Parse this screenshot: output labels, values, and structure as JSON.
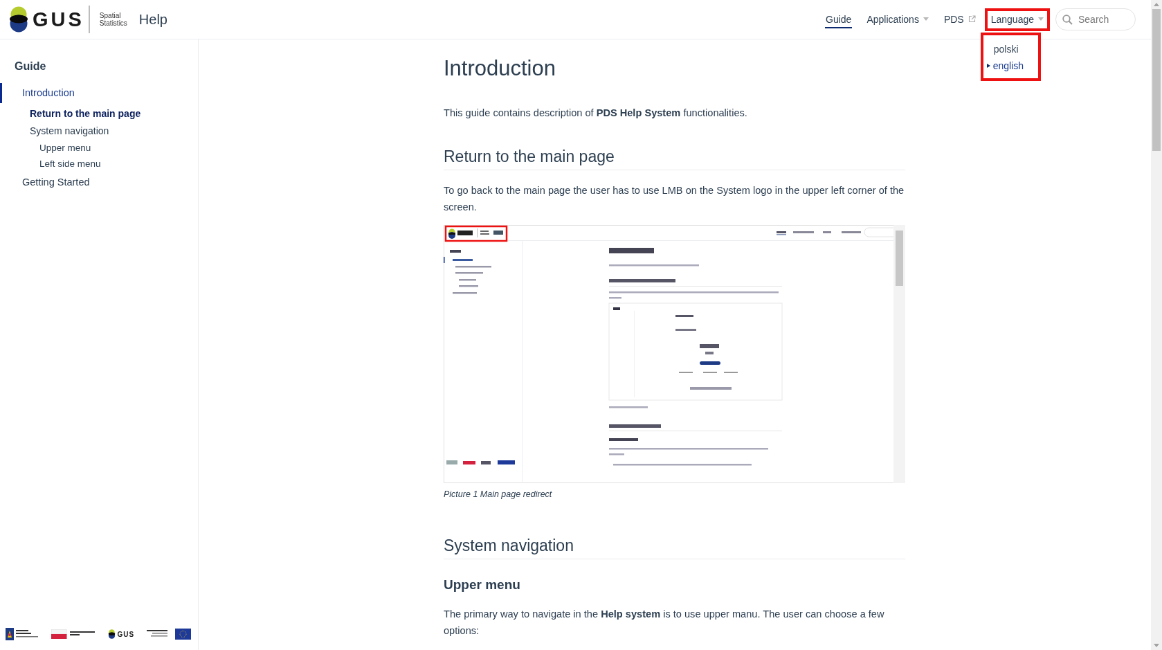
{
  "header": {
    "logo": {
      "wordmark": "GUS",
      "subtitle_1": "Spatial",
      "subtitle_2": "Statistics"
    },
    "title": "Help",
    "nav": [
      {
        "label": "Guide",
        "kind": "link",
        "selected": true,
        "highlighted": false
      },
      {
        "label": "Applications",
        "kind": "dropdown",
        "selected": false,
        "highlighted": false
      },
      {
        "label": "PDS",
        "kind": "external",
        "selected": false,
        "highlighted": false
      },
      {
        "label": "Language",
        "kind": "dropdown",
        "selected": false,
        "highlighted": true
      }
    ],
    "search": {
      "placeholder": "Search"
    },
    "language_menu": {
      "highlighted": true,
      "items": [
        {
          "label": "polski",
          "selected": false
        },
        {
          "label": "english",
          "selected": true
        }
      ]
    }
  },
  "sidebar": {
    "title": "Guide",
    "items": [
      {
        "label": "Introduction",
        "selected": true,
        "current": false,
        "children": [
          {
            "label": "Return to the main page",
            "selected": false,
            "current": true
          },
          {
            "label": "System navigation",
            "selected": false,
            "current": false,
            "children": [
              {
                "label": "Upper menu",
                "selected": false,
                "current": false
              },
              {
                "label": "Left side menu",
                "selected": false,
                "current": false
              }
            ]
          }
        ]
      },
      {
        "label": "Getting Started",
        "selected": false,
        "current": false
      }
    ],
    "footer_logos": [
      {
        "kind": "eu-funds"
      },
      {
        "kind": "poland"
      },
      {
        "kind": "gus",
        "wordmark": "GUS"
      },
      {
        "kind": "eu"
      }
    ]
  },
  "content": {
    "blocks": [
      {
        "kind": "h1",
        "text": "Introduction"
      },
      {
        "kind": "p",
        "text": "This guide contains description of **PDS Help System** functionalities."
      },
      {
        "kind": "h2",
        "text": "Return to the main page"
      },
      {
        "kind": "p",
        "text": "To go back to the main page the user has to use LMB on the System logo in the upper left corner of the screen."
      },
      {
        "kind": "figure",
        "caption": "Picture 1 Main page redirect"
      },
      {
        "kind": "h2",
        "text": "System navigation"
      },
      {
        "kind": "h3",
        "text": "Upper menu"
      },
      {
        "kind": "p",
        "text": "The primary way to navigate in the **Help system** is to use upper manu. The user can choose a few options:"
      }
    ]
  }
}
